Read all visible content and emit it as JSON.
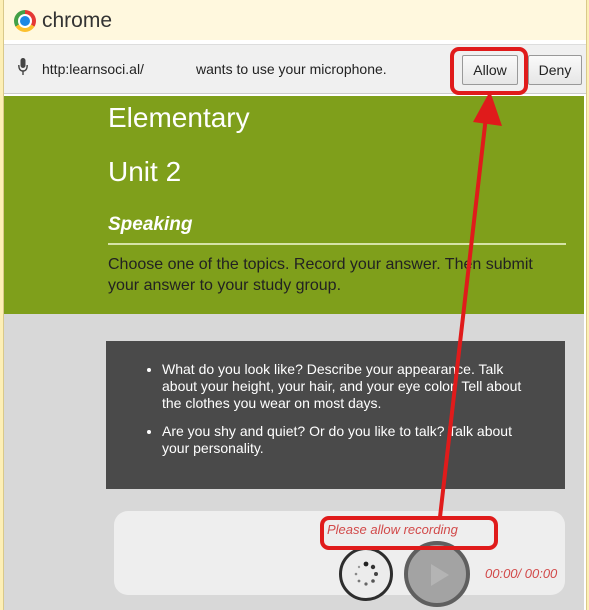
{
  "browser": {
    "app_name": "chrome"
  },
  "infobar": {
    "url": "http:learnsoci.al/",
    "message": "wants to use your microphone.",
    "allow_label": "Allow",
    "deny_label": "Deny"
  },
  "lesson": {
    "level": "Elementary",
    "unit": "Unit 2",
    "section": "Speaking",
    "instructions": "Choose one of the topics. Record your answer. Then submit your answer to your study group."
  },
  "topics": [
    "What do you look like? Describe your appearance. Talk about your height, your hair, and your eye color. Tell about the clothes you wear on most days.",
    "Are you shy and quiet? Or do you like to talk? Talk about your personality."
  ],
  "recorder": {
    "status": "Please allow recording",
    "time": "00:00/ 00:00"
  },
  "colors": {
    "banner_green": "#7f9f1b",
    "annotation_red": "#e01b1b",
    "topics_bg": "#4a4a4a"
  }
}
